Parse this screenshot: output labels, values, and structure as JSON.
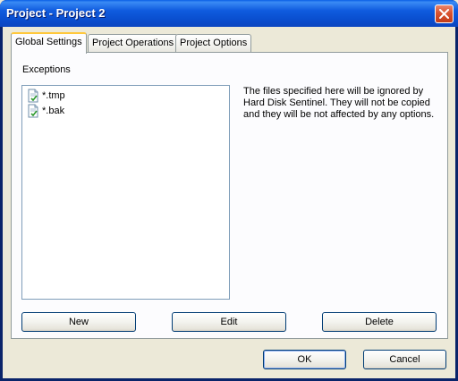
{
  "window": {
    "title": "Project - Project 2"
  },
  "tabs": [
    {
      "label": "Global Settings",
      "active": true
    },
    {
      "label": "Project Operations",
      "active": false
    },
    {
      "label": "Project Options",
      "active": false
    }
  ],
  "exceptions": {
    "label": "Exceptions",
    "items": [
      "*.tmp",
      "*.bak"
    ],
    "icon": "document-check-icon"
  },
  "info": {
    "text": "The files specified here will be ignored by Hard Disk Sentinel. They will not be copied and they will be not affected by any options."
  },
  "buttons": {
    "new": "New",
    "edit": "Edit",
    "delete": "Delete",
    "ok": "OK",
    "cancel": "Cancel"
  },
  "colors": {
    "titlebar": "#0A4FD0",
    "close": "#D9532F",
    "face": "#ECE9D8",
    "tab_highlight": "#FFC83C"
  }
}
